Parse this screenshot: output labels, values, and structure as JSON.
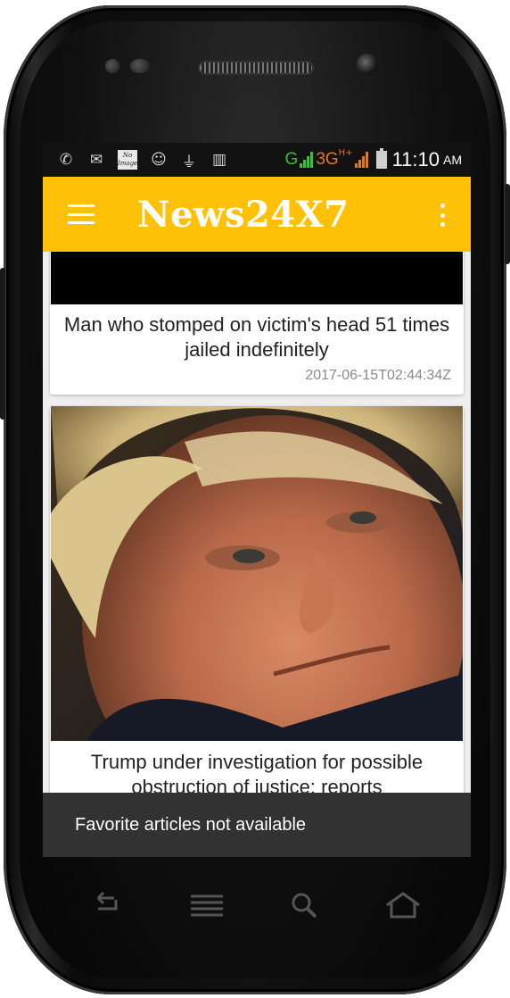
{
  "status_bar": {
    "network_g": "G",
    "network_3g": "3G",
    "network_hplus": "H+",
    "time": "11:10",
    "ampm": "AM",
    "no_image_text": "No Image",
    "icons": [
      "whatsapp-icon",
      "gmail-icon",
      "no-image-icon",
      "chat-icon",
      "usb-icon",
      "barcode-icon",
      "signal-icon",
      "battery-icon"
    ]
  },
  "toolbar": {
    "title": "News24X7",
    "background": "#ffc107"
  },
  "articles": [
    {
      "title": "Man who stomped on victim's head 51 times jailed indefinitely",
      "date": "2017-06-15T02:44:34Z"
    },
    {
      "title": "Trump under investigation for possible obstruction of justice: reports"
    }
  ],
  "snackbar": {
    "message": "Favorite articles not available"
  },
  "colors": {
    "accent": "#ffc107",
    "signal_g": "#35c335",
    "signal_3g": "#e8761d",
    "snackbar": "#323232"
  }
}
